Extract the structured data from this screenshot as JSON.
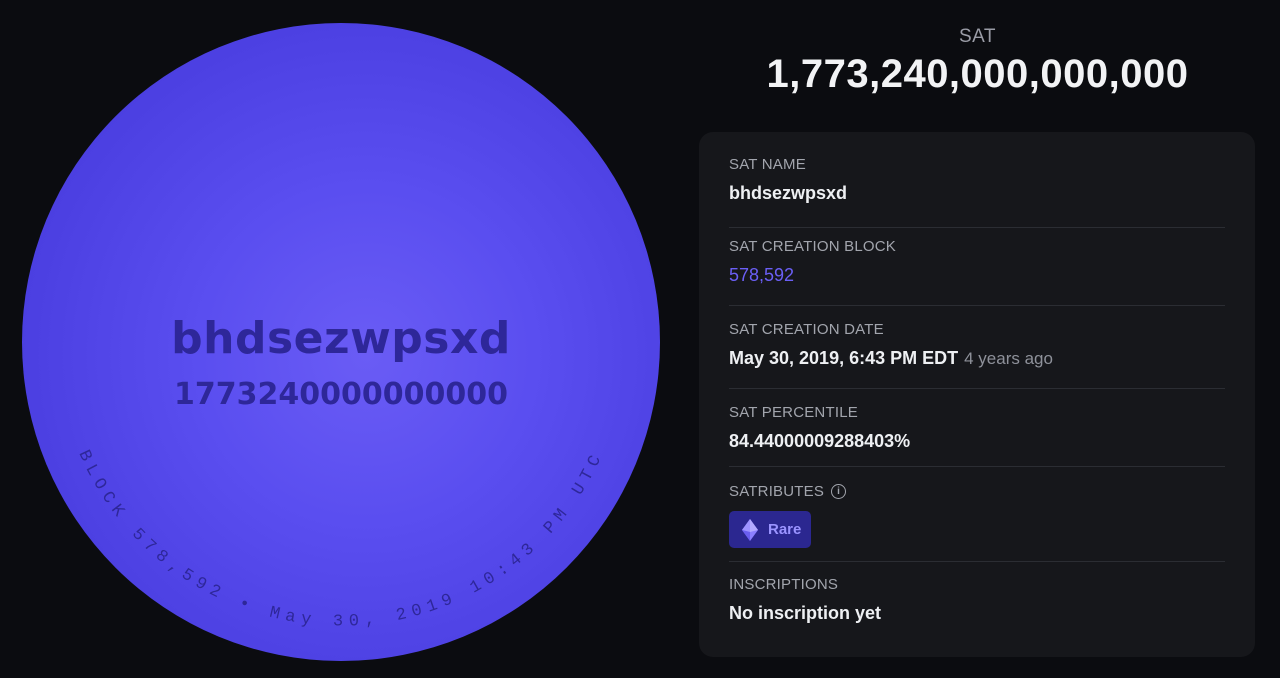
{
  "disc": {
    "name": "bhdsezwpsxd",
    "number": "1773240000000000",
    "arc_text": "BLOCK 578,592 • May 30, 2019 10:43 PM UTC",
    "color": "#5a4ef0",
    "text_color": "#2e2799"
  },
  "header": {
    "label": "SAT",
    "value": "1,773,240,000,000,000"
  },
  "card": {
    "sat_name": {
      "label": "SAT NAME",
      "value": "bhdsezwpsxd"
    },
    "creation_block": {
      "label": "SAT CREATION BLOCK",
      "value": "578,592"
    },
    "creation_date": {
      "label": "SAT CREATION DATE",
      "value": "May 30, 2019, 6:43 PM EDT",
      "relative": "4 years ago"
    },
    "percentile": {
      "label": "SAT PERCENTILE",
      "value": "84.44000009288403%"
    },
    "satributes": {
      "label": "SATRIBUTES",
      "info_icon": "info-icon",
      "badges": [
        {
          "label": "Rare",
          "icon": "gem-icon"
        }
      ]
    },
    "inscriptions": {
      "label": "INSCRIPTIONS",
      "value": "No inscription yet"
    }
  },
  "colors": {
    "background": "#0b0c10",
    "card": "#16171b",
    "accent": "#6b5ff6",
    "badge": "#2b2790"
  }
}
